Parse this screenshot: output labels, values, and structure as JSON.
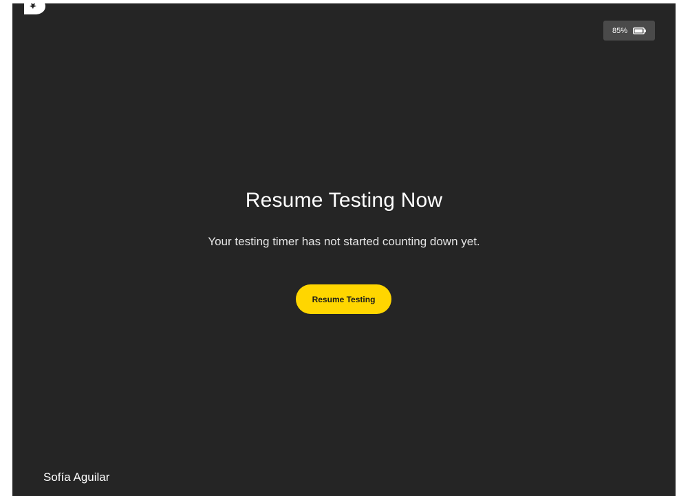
{
  "app": {
    "logo_icon": "app-logo-icon"
  },
  "status": {
    "battery_text": "85%",
    "battery_icon": "battery-icon"
  },
  "main": {
    "title": "Resume Testing Now",
    "subtitle": "Your testing timer has not started counting down yet.",
    "resume_button_label": "Resume Testing"
  },
  "user": {
    "name": "Sofía Aguilar"
  },
  "colors": {
    "background": "#252525",
    "accent": "#ffd600",
    "battery_badge": "#4a4a4a"
  }
}
